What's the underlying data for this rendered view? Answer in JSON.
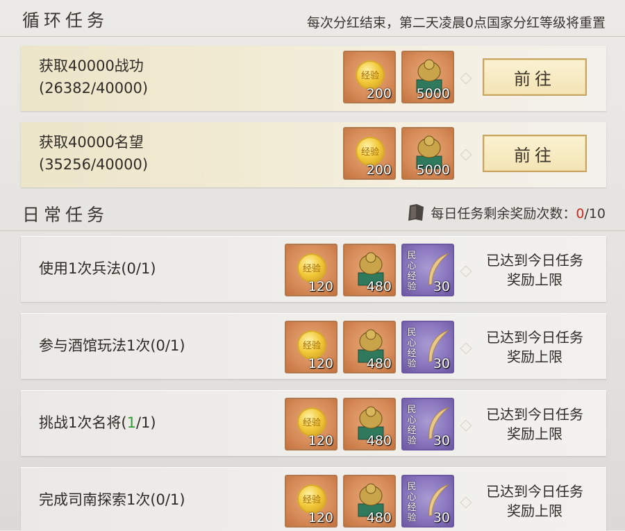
{
  "loop": {
    "title": "循环任务",
    "note": "每次分红结束，第二天凌晨0点国家分红等级将重置",
    "tasks": [
      {
        "name": "获取40000战功",
        "progress": "(26382/40000)",
        "rewards": [
          "200",
          "5000"
        ],
        "exp_icon": "经验",
        "button": "前往"
      },
      {
        "name": "获取40000名望",
        "progress": "(35256/40000)",
        "rewards": [
          "200",
          "5000"
        ],
        "exp_icon": "经验",
        "button": "前往"
      }
    ]
  },
  "daily": {
    "title": "日常任务",
    "count_label": "每日任务剩余奖励次数：",
    "count_value": "0",
    "count_total": "/10",
    "tasks": [
      {
        "name": "使用1次兵法(0/1)",
        "rewards": [
          "120",
          "480",
          "30"
        ],
        "status": "已达到今日任务",
        "status2": "奖励上限"
      },
      {
        "name": "参与酒馆玩法1次(0/1)",
        "rewards": [
          "120",
          "480",
          "30"
        ],
        "status": "已达到今日任务",
        "status2": "奖励上限"
      },
      {
        "name_pre": "挑战1次名将(",
        "name_hl": "1",
        "name_post": "/1)",
        "rewards": [
          "120",
          "480",
          "30"
        ],
        "status": "已达到今日任务",
        "status2": "奖励上限"
      },
      {
        "name": "完成司南探索1次(0/1)",
        "rewards": [
          "120",
          "480",
          "30"
        ],
        "status": "已达到今日任务",
        "status2": "奖励上限"
      }
    ]
  },
  "icons": {
    "exp_text": "经验",
    "minxin_text": "民心经验",
    "highlight_color": "#2f9b33",
    "count_color": "#c8281e"
  }
}
